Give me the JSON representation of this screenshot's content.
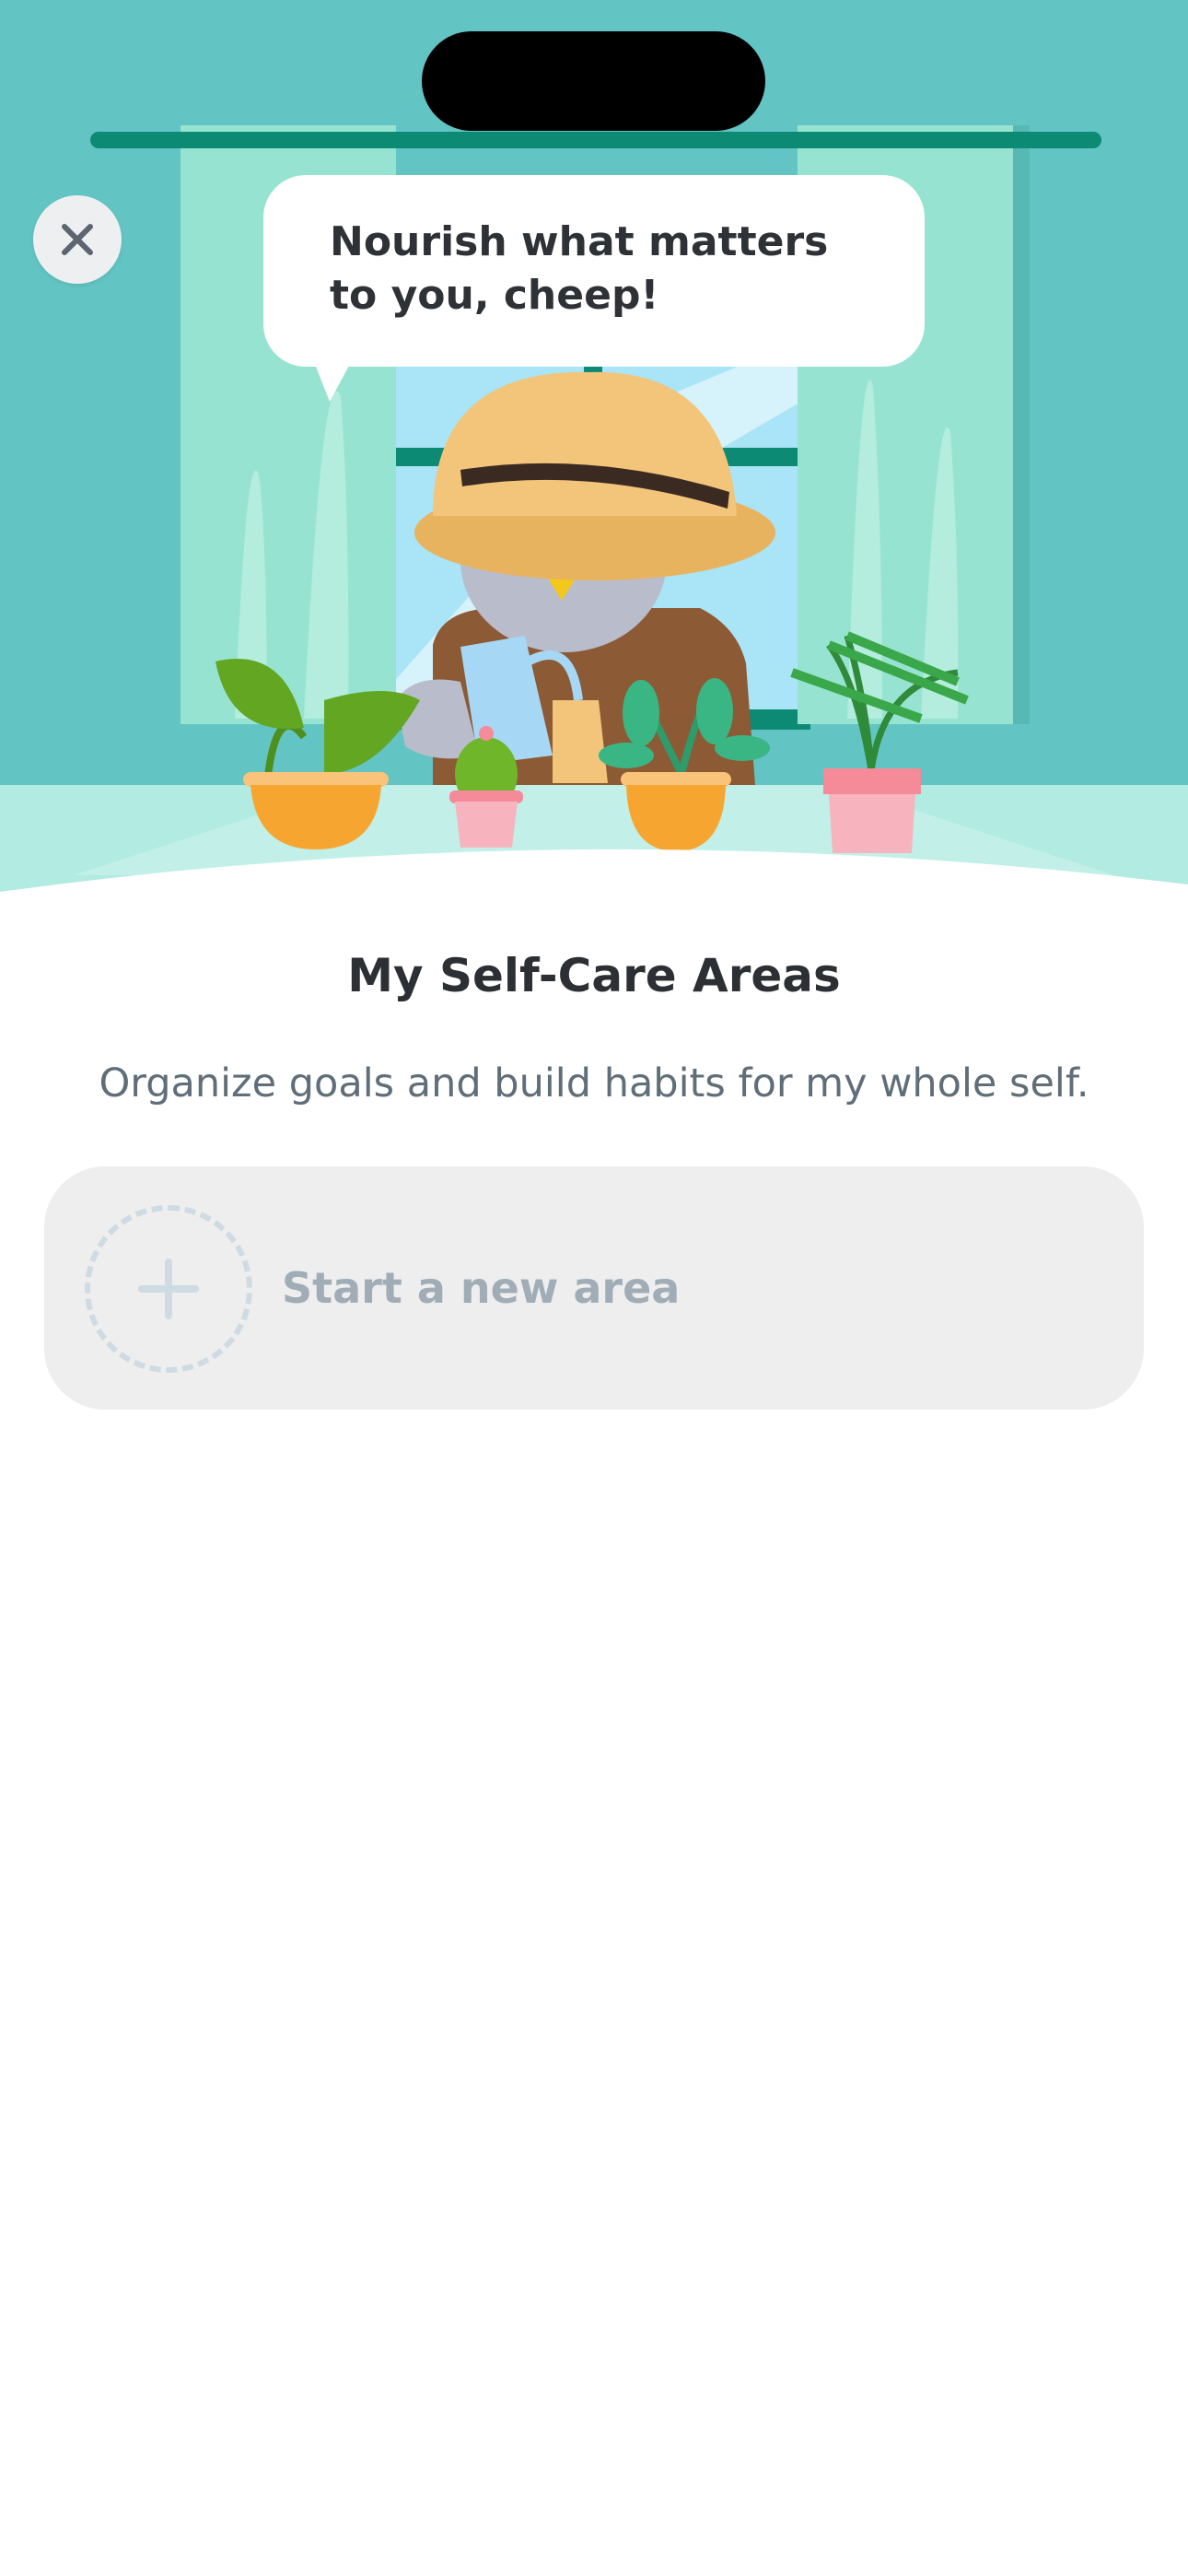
{
  "hero": {
    "speech_bubble": "Nourish what matters to you, cheep!",
    "illustration": "bird-gardener-watering-plants-at-window"
  },
  "close_button": {
    "icon": "close-icon"
  },
  "main": {
    "title": "My Self-Care Areas",
    "subtitle": "Organize goals and build habits for my whole self.",
    "new_area": {
      "label": "Start a new area",
      "icon": "plus-icon"
    }
  },
  "colors": {
    "wall": "#63c4c4",
    "curtain": "#97e3d1",
    "rod": "#0c8a73",
    "sky": "#a9e4f7",
    "floor": "#b1ebe2",
    "hat": "#f2c57a",
    "pot_orange": "#f7a531",
    "pot_pink": "#f58a99",
    "card_bg": "#eeeeee",
    "title_text": "#2c2f33",
    "subtitle_text": "#5f6e78",
    "muted_text": "#a1adb6"
  }
}
